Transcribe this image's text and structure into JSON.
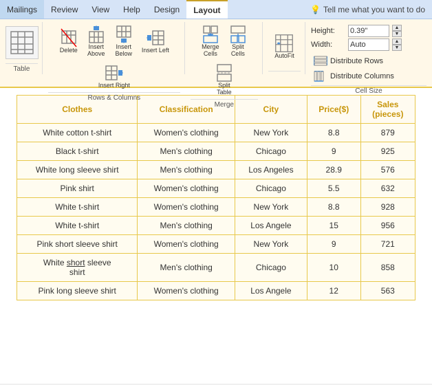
{
  "menu": {
    "items": [
      {
        "label": "Mailings",
        "active": false
      },
      {
        "label": "Review",
        "active": false
      },
      {
        "label": "View",
        "active": false
      },
      {
        "label": "Help",
        "active": false
      },
      {
        "label": "Design",
        "active": false
      },
      {
        "label": "Layout",
        "active": true
      }
    ],
    "tellme": "Tell me what you want to do"
  },
  "ribbon": {
    "groups": [
      {
        "name": "rows-columns",
        "buttons": [
          {
            "label": "Insert\nLeft",
            "icon": "⬛⬜"
          },
          {
            "label": "Insert\nRight",
            "icon": "⬜⬛"
          }
        ],
        "group_label": ""
      },
      {
        "name": "merge",
        "buttons": [
          {
            "label": "Merge\nCells",
            "icon": "⊞"
          },
          {
            "label": "Split\nCells",
            "icon": "⊟"
          },
          {
            "label": "Split\nTable",
            "icon": "⊠"
          }
        ],
        "group_label": "Merge"
      },
      {
        "name": "autofit",
        "buttons": [
          {
            "label": "AutoFit",
            "icon": "↔"
          }
        ],
        "group_label": ""
      }
    ],
    "cell_size": {
      "height_label": "Height:",
      "height_value": "0.39\"",
      "width_label": "Width:",
      "width_value": "Auto"
    },
    "distribute": {
      "rows_label": "Distribute Rows",
      "columns_label": "Distribute Columns"
    },
    "group_labels": {
      "table": "Table",
      "rows_columns": "Rows & Columns",
      "merge": "Merge",
      "cell_size": "Cell Size"
    }
  },
  "table": {
    "headers": [
      "Clothes",
      "Classification",
      "City",
      "Price($)",
      "Sales\n(pieces)"
    ],
    "rows": [
      [
        "White cotton t-shirt",
        "Women's clothing",
        "New York",
        "8.8",
        "879"
      ],
      [
        "Black t-shirt",
        "Men's clothing",
        "Chicago",
        "9",
        "925"
      ],
      [
        "White long sleeve shirt",
        "Men's clothing",
        "Los Angeles",
        "28.9",
        "576"
      ],
      [
        "Pink shirt",
        "Women's clothing",
        "Chicago",
        "5.5",
        "632"
      ],
      [
        "White t-shirt",
        "Women's clothing",
        "New York",
        "8.8",
        "928"
      ],
      [
        "White t-shirt",
        "Men's clothing",
        "Los Angele",
        "15",
        "956"
      ],
      [
        "Pink short sleeve shirt",
        "Women's clothing",
        "New York",
        "9",
        "721"
      ],
      [
        "White short sleeve shirt",
        "Men's clothing",
        "Chicago",
        "10",
        "858"
      ],
      [
        "Pink long sleeve shirt",
        "Women's clothing",
        "Los Angele",
        "12",
        "563"
      ]
    ],
    "underline_row": 7,
    "underline_word_index": 1
  }
}
